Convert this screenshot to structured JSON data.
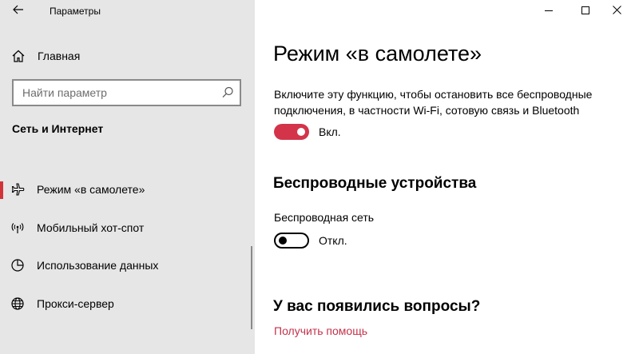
{
  "window": {
    "title": "Параметры",
    "controls": {
      "minimize_icon": "minimize-icon",
      "maximize_icon": "maximize-icon",
      "close_icon": "close-icon"
    }
  },
  "sidebar": {
    "back_icon": "back-arrow-icon",
    "home": {
      "label": "Главная",
      "icon": "home-icon"
    },
    "search": {
      "placeholder": "Найти параметр",
      "value": "",
      "icon": "search-icon"
    },
    "section_title": "Сеть и Интернет",
    "items": [
      {
        "label": "Режим «в самолете»",
        "icon": "airplane-icon",
        "selected": true
      },
      {
        "label": "Мобильный хот-спот",
        "icon": "hotspot-icon",
        "selected": false
      },
      {
        "label": "Использование данных",
        "icon": "data-usage-icon",
        "selected": false
      },
      {
        "label": "Прокси-сервер",
        "icon": "globe-icon",
        "selected": false
      }
    ]
  },
  "main": {
    "title": "Режим «в самолете»",
    "description": "Включите эту функцию, чтобы остановить все беспроводные подключения, в частности Wi-Fi, сотовую связь и Bluetooth",
    "airplane_toggle": {
      "state": "on",
      "label": "Вкл."
    },
    "wireless_heading": "Беспроводные устройства",
    "wifi_label": "Беспроводная сеть",
    "wifi_toggle": {
      "state": "off",
      "label": "Откл."
    },
    "help_heading": "У вас появились вопросы?",
    "help_link": "Получить помощь"
  },
  "colors": {
    "sidebar_bg": "#e6e6e6",
    "accent": "#d3344a",
    "link": "#c3324a",
    "selected_indicator": "#d13438"
  }
}
